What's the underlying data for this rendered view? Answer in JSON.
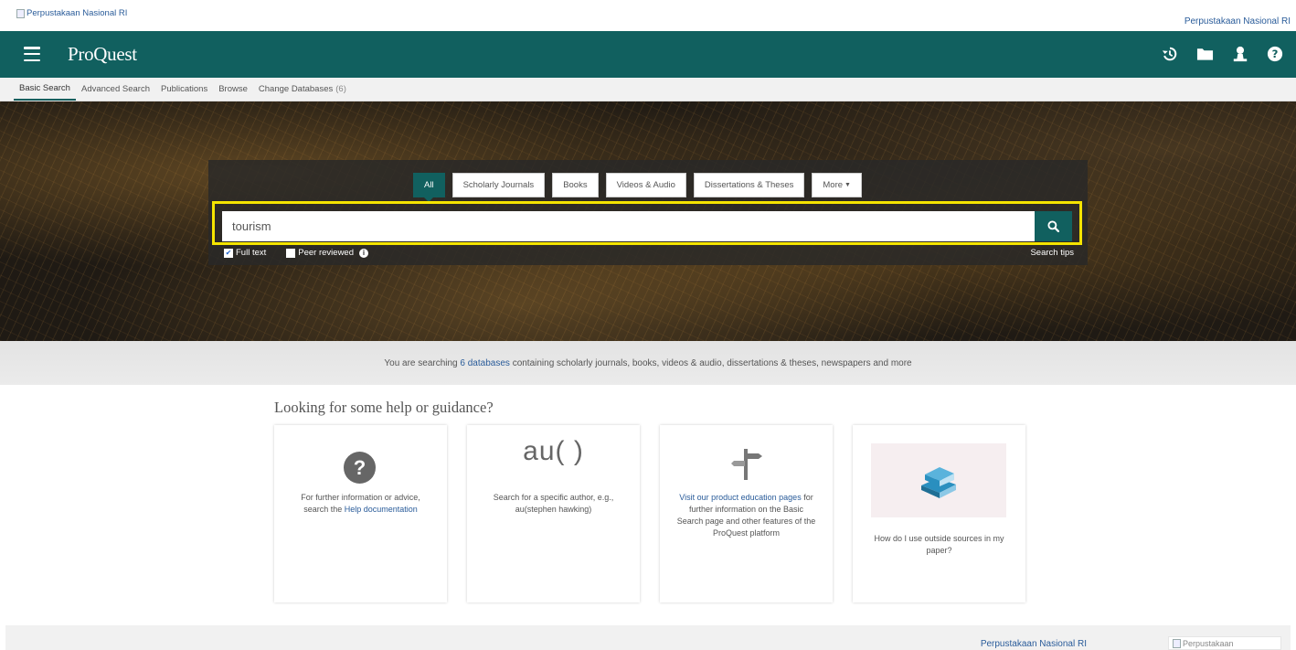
{
  "topbar": {
    "library_logo_alt": "Perpustakaan Nasional RI",
    "library_link": "Perpustakaan Nasional RI"
  },
  "header": {
    "logo": "ProQuest",
    "brand_color": "#11605f",
    "icons": [
      "menu-icon",
      "history-icon",
      "folder-icon",
      "user-icon",
      "help-icon"
    ]
  },
  "nav": {
    "tabs": [
      {
        "label": "Basic Search",
        "active": true
      },
      {
        "label": "Advanced Search"
      },
      {
        "label": "Publications"
      },
      {
        "label": "Browse"
      },
      {
        "label": "Change Databases",
        "count": "(6)"
      }
    ]
  },
  "search": {
    "source_types": [
      "All",
      "Scholarly Journals",
      "Books",
      "Videos & Audio",
      "Dissertations & Theses",
      "More"
    ],
    "active_source": "All",
    "query": "tourism",
    "full_text_label": "Full text",
    "full_text_checked": true,
    "peer_reviewed_label": "Peer reviewed",
    "peer_reviewed_checked": false,
    "search_tips": "Search tips",
    "highlight_color": "#f5e400"
  },
  "databases": {
    "prefix": "You are searching",
    "link": "6 databases",
    "suffix": "containing scholarly journals, books, videos & audio, dissertations & theses, newspapers and more"
  },
  "help": {
    "title": "Looking for some help or guidance?",
    "cards": [
      {
        "icon": "question-circle-icon",
        "text_before": "For further information or advice, search the",
        "link": "Help documentation",
        "text_after": ""
      },
      {
        "icon": "au-function-icon",
        "icon_text": "au( )",
        "text": "Search for a specific author, e.g., au(stephen hawking)"
      },
      {
        "icon": "signpost-icon",
        "link": "Visit our product education pages",
        "text_after": "for further information on the Basic Search page and other features of the ProQuest platform"
      },
      {
        "icon": "books-image",
        "text": "How do I use outside sources in my paper?"
      }
    ]
  },
  "footer": {
    "library_link": "Perpustakaan Nasional RI",
    "logo_alt": "Perpustakaan"
  }
}
